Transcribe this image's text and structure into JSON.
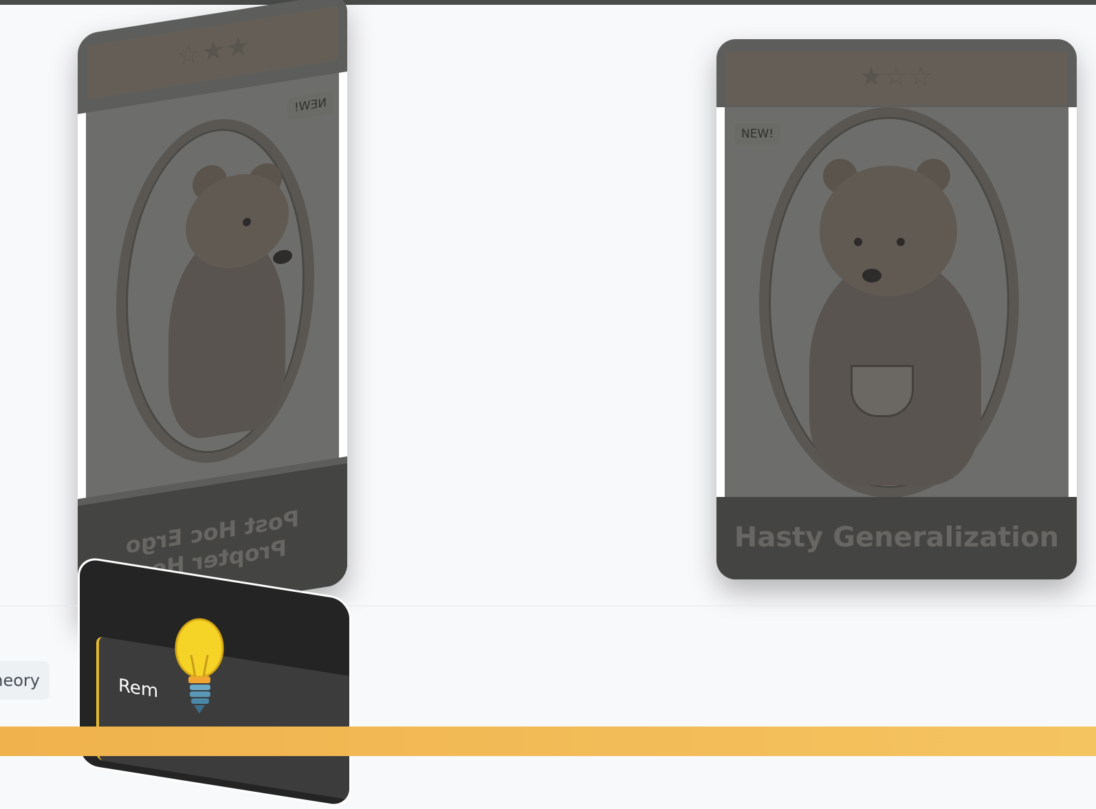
{
  "cards": {
    "left": {
      "title": "Post Hoc Ergo Propter Hoc",
      "badge": "NEW!",
      "stars": "★★☆"
    },
    "right": {
      "title": "Hasty Generalization",
      "badge": "NEW!",
      "stars": "★☆☆"
    }
  },
  "chip": {
    "label": "heory"
  },
  "tip": {
    "text": "Rem"
  },
  "colors": {
    "page_bg": "#f8f9fb",
    "card_body": "#5d5e5c",
    "card_footer": "#444442",
    "accent_bar": "#f2b955"
  },
  "icons": {
    "tip": "lightbulb-icon",
    "rating": "star-icon"
  }
}
